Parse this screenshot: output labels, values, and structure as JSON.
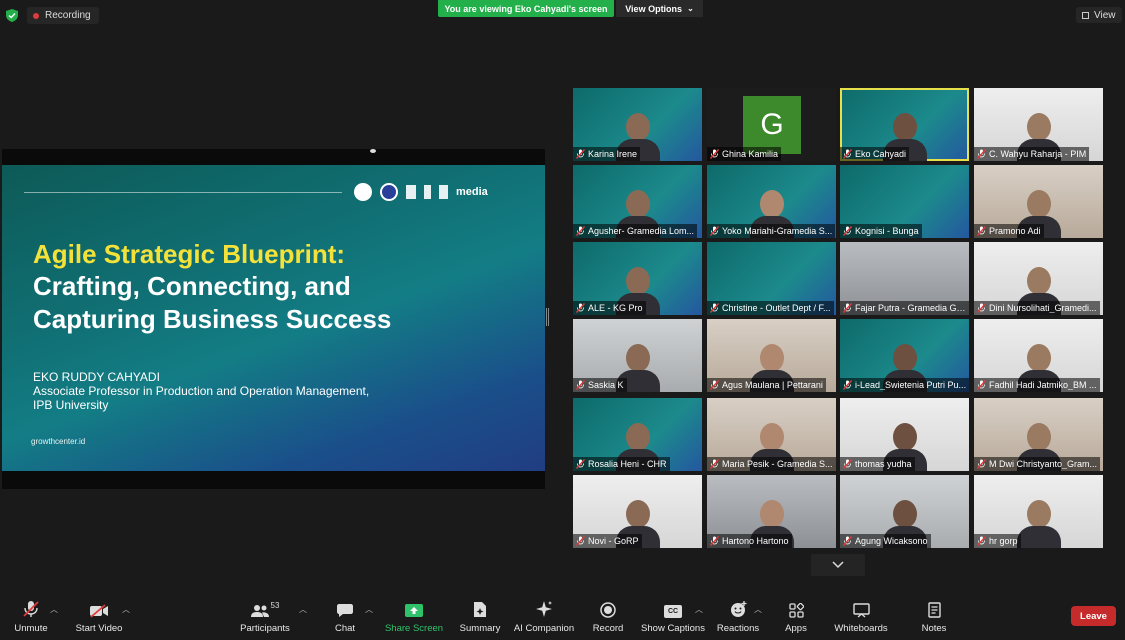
{
  "top_bar": {
    "recording_label": "Recording",
    "viewing_banner": "You are viewing Eko Cahyadi's screen",
    "view_options": "View Options",
    "view_button": "View"
  },
  "slide": {
    "title_line1": "Agile Strategic Blueprint:",
    "title_line2": "Crafting, Connecting, and",
    "title_line3": "Capturing Business Success",
    "speaker_name": "EKO RUDDY CAHYADI",
    "speaker_role": "Associate Professor in Production and Operation Management,",
    "speaker_org": "IPB University",
    "footer": "growthcenter.id",
    "logo_text": "media"
  },
  "participants_grid": [
    {
      "name": "Karina Irene",
      "bg": "teal",
      "avatar": "person"
    },
    {
      "name": "Ghina Kamilia",
      "bg": "dark",
      "avatar": "G"
    },
    {
      "name": "Eko Cahyadi",
      "bg": "teal",
      "avatar": "person",
      "active": true
    },
    {
      "name": "C. Wahyu Raharja - PIM",
      "bg": "white",
      "avatar": "person"
    },
    {
      "name": "Agusher- Gramedia Lom...",
      "bg": "teal",
      "avatar": "person"
    },
    {
      "name": "Yoko Mariahi-Gramedia S...",
      "bg": "teal",
      "avatar": "person"
    },
    {
      "name": "Kognisi - Bunga",
      "bg": "teal",
      "avatar": "none"
    },
    {
      "name": "Pramono Adi",
      "bg": "warm",
      "avatar": "person"
    },
    {
      "name": "ALE - KG Pro",
      "bg": "teal",
      "avatar": "person"
    },
    {
      "name": "Christine - Outlet Dept / F...",
      "bg": "teal",
      "avatar": "none"
    },
    {
      "name": "Fajar Putra - Gramedia Ga...",
      "bg": "store",
      "avatar": "none"
    },
    {
      "name": "Dini Nursolihati_Gramedi...",
      "bg": "white",
      "avatar": "person"
    },
    {
      "name": "Saskia K",
      "bg": "room",
      "avatar": "person"
    },
    {
      "name": "Agus Maulana | Pettarani",
      "bg": "warm",
      "avatar": "person"
    },
    {
      "name": "i-Lead_Swietenia Putri Pu...",
      "bg": "teal",
      "avatar": "person"
    },
    {
      "name": "Fadhil Hadi Jatmiko_BM ...",
      "bg": "white",
      "avatar": "person"
    },
    {
      "name": "Rosalia Heni - CHR",
      "bg": "teal",
      "avatar": "person"
    },
    {
      "name": "Maria Pesik - Gramedia S...",
      "bg": "warm",
      "avatar": "person"
    },
    {
      "name": "thomas yudha",
      "bg": "white",
      "avatar": "person"
    },
    {
      "name": "M Dwi Christyanto_Gram...",
      "bg": "warm",
      "avatar": "person"
    },
    {
      "name": "Novi - GoRP",
      "bg": "white",
      "avatar": "person"
    },
    {
      "name": "Hartono Hartono",
      "bg": "store",
      "avatar": "person"
    },
    {
      "name": "Agung Wicaksono",
      "bg": "room",
      "avatar": "person"
    },
    {
      "name": "hr gorp",
      "bg": "white",
      "avatar": "person"
    }
  ],
  "toolbar": {
    "unmute": "Unmute",
    "start_video": "Start Video",
    "participants": "Participants",
    "participants_count": "53",
    "chat": "Chat",
    "share_screen": "Share Screen",
    "summary": "Summary",
    "ai_companion": "AI Companion",
    "record": "Record",
    "show_captions": "Show Captions",
    "captions_icon_text": "CC",
    "reactions": "Reactions",
    "apps": "Apps",
    "whiteboards": "Whiteboards",
    "notes": "Notes",
    "leave": "Leave"
  },
  "colors": {
    "share_green": "#23b04b",
    "leave_red": "#c62b2b",
    "active_speaker": "#e6e04a",
    "slide_yellow": "#f4e23a"
  }
}
